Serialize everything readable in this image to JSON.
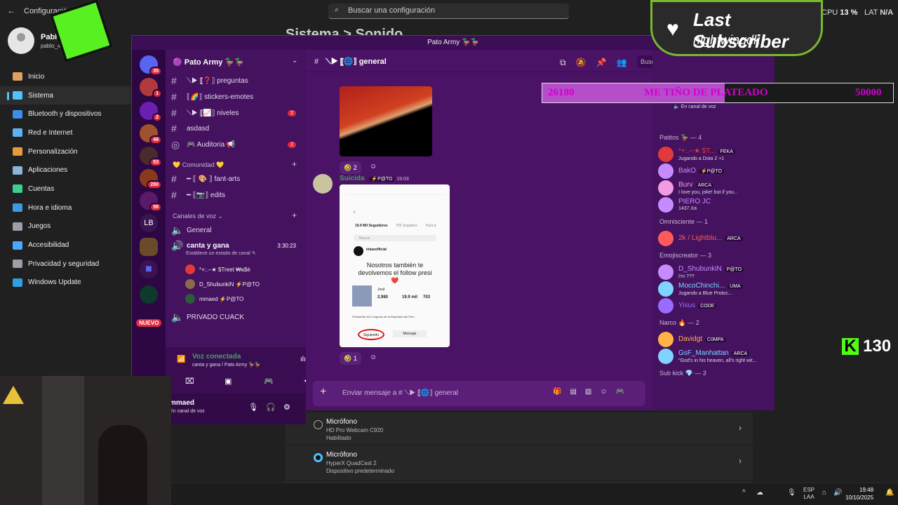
{
  "settings": {
    "window_title": "Configuración",
    "search_placeholder": "Buscar una configuración",
    "cpu_label": "CPU",
    "cpu_value": "13 %",
    "lat_label": "LAT",
    "lat_value": "N/A",
    "profile_name": "Pablo",
    "profile_email": "pablo_4549...ook.com",
    "page_title": "Sistema  >  Sonido",
    "nav": [
      {
        "label": "Inicio",
        "icon": "home-icon",
        "color": "#e0a060"
      },
      {
        "label": "Sistema",
        "icon": "system-icon",
        "color": "#4cc2ff"
      },
      {
        "label": "Bluetooth y dispositivos",
        "icon": "bluetooth-icon",
        "color": "#3b8eea"
      },
      {
        "label": "Red e Internet",
        "icon": "wifi-icon",
        "color": "#5fb2f0"
      },
      {
        "label": "Personalización",
        "icon": "brush-icon",
        "color": "#e79a3c"
      },
      {
        "label": "Aplicaciones",
        "icon": "apps-icon",
        "color": "#8ab4d8"
      },
      {
        "label": "Cuentas",
        "icon": "account-icon",
        "color": "#3ccf91"
      },
      {
        "label": "Hora e idioma",
        "icon": "globe-icon",
        "color": "#3c9be0"
      },
      {
        "label": "Juegos",
        "icon": "gamepad-icon",
        "color": "#9aa0a6"
      },
      {
        "label": "Accesibilidad",
        "icon": "accessibility-icon",
        "color": "#4aa8ff"
      },
      {
        "label": "Privacidad y seguridad",
        "icon": "shield-icon",
        "color": "#9aa0a6"
      },
      {
        "label": "Windows Update",
        "icon": "update-icon",
        "color": "#2f9fe0"
      }
    ],
    "mics": [
      {
        "title": "Micrófono",
        "device": "HD Pro Webcam C920",
        "status": "Habilitado",
        "selected": false
      },
      {
        "title": "Micrófono",
        "device": "HyperX QuadCast 2",
        "status": "Dispositivo predeterminado",
        "selected": true
      }
    ]
  },
  "taskbar": {
    "lang1": "ESP",
    "lang2": "LAA",
    "time": "19:48",
    "date": "10/10/2025"
  },
  "discord": {
    "window_title": "Pato Army",
    "guild_name": "Pato Army",
    "server_badges": [
      "35",
      "1",
      "2",
      "280",
      "48",
      "53",
      "2",
      "58"
    ],
    "server_lb": "LB",
    "new_label": "NUEVO",
    "channels": [
      {
        "name": "⟍▶ ⟦❓⟧ preguntas",
        "badge": ""
      },
      {
        "name": "⟦🌈⟧ stickers-emotes",
        "badge": ""
      },
      {
        "name": "⟍▶ ⟦📈⟧ niveles",
        "badge": "2"
      },
      {
        "name": "asdasd",
        "badge": ""
      },
      {
        "name": "🎮 Auditoria 📢",
        "badge": "2"
      }
    ],
    "cat_comunidad": "Comunidad",
    "channels2": [
      {
        "name": "━ ⟦ 🎨 ⟧ fant-arts"
      },
      {
        "name": "━ ⟦📷⟧ edits"
      }
    ],
    "cat_voice": "Canales de voz",
    "voice_general": "General",
    "voice_active": "canta y gana",
    "voice_timer": "3:30:23",
    "voice_status_hint": "Establece un estado de canal",
    "voice_users": [
      "*+:.--★ $Treet  ₩a$ė",
      "D_ShubunkiN  ⚡P@TO",
      "mmaed  ⚡P@TO"
    ],
    "voice_private": "PRIVADO CUACK",
    "voice_connected": "Voz conectada",
    "voice_connected_sub": "canta y gana / Pato Army",
    "user_name": "mmaed",
    "user_sub": "En canal de voz",
    "channel_name": "⟍▶ ⟦🌐⟧ general",
    "search_label": "Buscar",
    "reaction1": "2",
    "msg_author": "Suicida",
    "msg_author_tag": "⚡P@TO",
    "msg_time": "19:03",
    "reaction2": "1",
    "input_placeholder": "Enviar mensaje a # ⟍▶ ⟦🌐⟧ general",
    "embed": {
      "followers": "19.9 Mil Seguidores",
      "following": "703 Seguidos",
      "para": "Para ti",
      "search": "Buscar",
      "account": "inkasofficial",
      "headline": "Nosotros también te devolvemos el follow presi❤️",
      "person": "José",
      "stat1": "2,980",
      "stat2": "19.9 mil",
      "stat3": "703",
      "bio": "Presidente del Congreso de la República del Perú",
      "btn1": "Siguiendo",
      "btn2": "Mensaje"
    },
    "members": {
      "voice_hint": "En canal de voz",
      "groups": [
        {
          "label": "Patitos 🦆 — 4",
          "items": [
            {
              "name": "*+:.--★ $T...",
              "tag": "FEKA",
              "status": "Jugando a Dota 2 +1",
              "color": "#e23a3a"
            },
            {
              "name": "BakO",
              "tag": "⚡P@TO",
              "status": "",
              "color": "#c68cff"
            },
            {
              "name": "Burv",
              "tag": "ARCA",
              "status": "I love you, joke! but if you...",
              "color": "#f29be0"
            },
            {
              "name": "PIERO JC",
              "tag": "",
              "status": "1437.Xa",
              "color": "#c68cff"
            }
          ]
        },
        {
          "label": "Omnisciente — 1",
          "items": [
            {
              "name": "2k / Lightblu...",
              "tag": "ARCA",
              "status": "",
              "color": "#ff5a5a"
            }
          ]
        },
        {
          "label": "Emojiscreator — 3",
          "items": [
            {
              "name": "D_ShubunkiN",
              "tag": "P@TO",
              "status": "I'm ???",
              "color": "#c68cff"
            },
            {
              "name": "MocoChinchi...",
              "tag": "UMA",
              "status": "Jugando a Blue Protoc...",
              "color": "#7fd3ff"
            },
            {
              "name": "Yisus",
              "tag": "CODE",
              "status": "",
              "color": "#9b6bff"
            }
          ]
        },
        {
          "label": "Narco 🔥 — 2",
          "items": [
            {
              "name": "Davidgt",
              "tag": "C0MPA",
              "status": "",
              "color": "#ffb347"
            },
            {
              "name": "GsF_Manhattan",
              "tag": "ARCA",
              "status": "\"God's in his heaven, all's right wit...",
              "color": "#7fd3ff"
            }
          ]
        },
        {
          "label": "Sub kick 💎 — 3",
          "items": []
        }
      ]
    }
  },
  "overlay": {
    "sub_title": "Last Subscriber",
    "sub_name": "nightwingdk",
    "goal_current": "26180",
    "goal_text": "ME TIÑO DE PLATEADO",
    "goal_target": "50000",
    "goal_progress": 0.52,
    "kick_count": "130"
  }
}
